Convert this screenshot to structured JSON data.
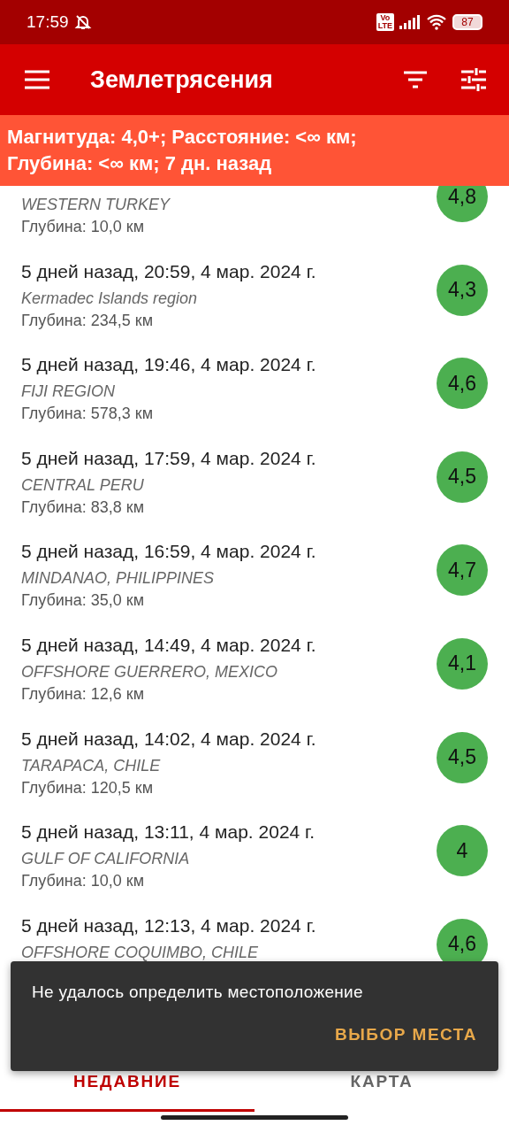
{
  "status_bar": {
    "time": "17:59",
    "network_badge": [
      "Vo",
      "LTE"
    ],
    "battery": "87"
  },
  "toolbar": {
    "title": "Землетрясения"
  },
  "filter_banner": [
    "Магнитуда: 4,0+; Расстояние: <∞ км;",
    "Глубина: <∞ км; 7 дн. назад"
  ],
  "quakes": [
    {
      "region": "WESTERN TURKEY",
      "depth": "Глубина: 10,0 км",
      "magnitude": "4,8",
      "color": "#4caf50"
    },
    {
      "time": "5 дней назад, 20:59, 4 мар. 2024 г.",
      "region": "Kermadec Islands region",
      "depth": "Глубина: 234,5 км",
      "magnitude": "4,3",
      "color": "#4caf50"
    },
    {
      "time": "5 дней назад, 19:46, 4 мар. 2024 г.",
      "region": "FIJI REGION",
      "depth": "Глубина: 578,3 км",
      "magnitude": "4,6",
      "color": "#4caf50"
    },
    {
      "time": "5 дней назад, 17:59, 4 мар. 2024 г.",
      "region": "CENTRAL PERU",
      "depth": "Глубина: 83,8 км",
      "magnitude": "4,5",
      "color": "#4caf50"
    },
    {
      "time": "5 дней назад, 16:59, 4 мар. 2024 г.",
      "region": "MINDANAO, PHILIPPINES",
      "depth": "Глубина: 35,0 км",
      "magnitude": "4,7",
      "color": "#4caf50"
    },
    {
      "time": "5 дней назад, 14:49, 4 мар. 2024 г.",
      "region": "OFFSHORE GUERRERO, MEXICO",
      "depth": "Глубина: 12,6 км",
      "magnitude": "4,1",
      "color": "#4caf50"
    },
    {
      "time": "5 дней назад, 14:02, 4 мар. 2024 г.",
      "region": "TARAPACA, CHILE",
      "depth": "Глубина: 120,5 км",
      "magnitude": "4,5",
      "color": "#4caf50"
    },
    {
      "time": "5 дней назад, 13:11, 4 мар. 2024 г.",
      "region": "GULF OF CALIFORNIA",
      "depth": "Глубина: 10,0 км",
      "magnitude": "4",
      "color": "#4caf50"
    },
    {
      "time": "5 дней назад, 12:13, 4 мар. 2024 г.",
      "region": "OFFSHORE COQUIMBO, CHILE",
      "magnitude": "4,6",
      "color": "#4caf50"
    }
  ],
  "snackbar": {
    "message": "Не удалось определить местоположение",
    "action": "ВЫБОР МЕСТА"
  },
  "tabs": [
    {
      "label": "НЕДАВНИЕ",
      "selected": true
    },
    {
      "label": "КАРТА",
      "selected": false
    }
  ]
}
